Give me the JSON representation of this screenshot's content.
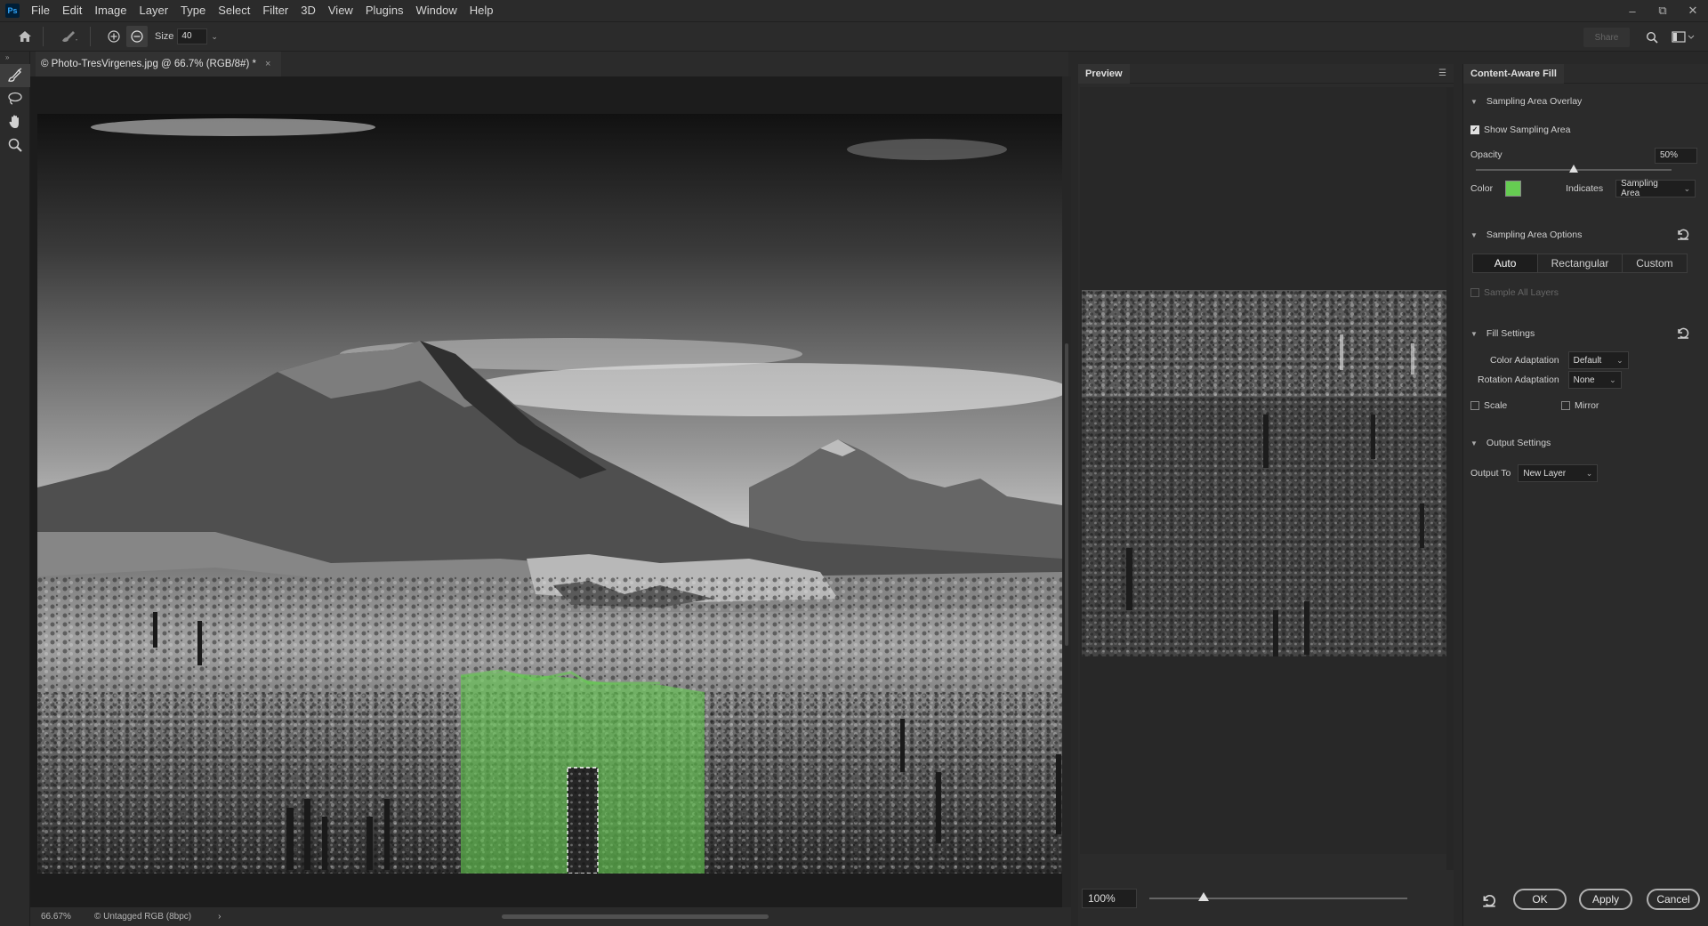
{
  "menu": {
    "app_icon": "Ps",
    "items": [
      "File",
      "Edit",
      "Image",
      "Layer",
      "Type",
      "Select",
      "Filter",
      "3D",
      "View",
      "Plugins",
      "Window",
      "Help"
    ]
  },
  "window_controls": {
    "minimize": "–",
    "restore": "⧉",
    "close": "✕"
  },
  "options_bar": {
    "size_label": "Size",
    "size_value": "40",
    "share_label": "Share",
    "icons": [
      "home-icon",
      "brush-tool-icon",
      "add-mode-icon",
      "subtract-mode-icon",
      "search-icon",
      "workspace-icon"
    ]
  },
  "tools": [
    {
      "name": "sampling-brush-tool",
      "active": true
    },
    {
      "name": "lasso-tool",
      "active": false
    },
    {
      "name": "hand-tool",
      "active": false
    },
    {
      "name": "zoom-tool",
      "active": false
    }
  ],
  "document": {
    "tab_title": "© Photo-TresVirgenes.jpg @ 66.7% (RGB/8#) *",
    "close": "×"
  },
  "status": {
    "zoom": "66.67%",
    "doc_info": "© Untagged RGB (8bpc)",
    "arrow": "›"
  },
  "preview": {
    "title": "Preview",
    "zoom_value": "100%",
    "zoom_slider_fraction": 0.21
  },
  "caf": {
    "title": "Content-Aware Fill",
    "overlay_section": "Sampling Area Overlay",
    "show_sampling_area": {
      "label": "Show Sampling Area",
      "checked": true
    },
    "opacity_label": "Opacity",
    "opacity_value": "50%",
    "opacity_fraction": 0.5,
    "color_label": "Color",
    "overlay_color": "#66cc52",
    "indicates_label": "Indicates",
    "indicates_value": "Sampling Area",
    "options_section": "Sampling Area Options",
    "sampling_modes": [
      "Auto",
      "Rectangular",
      "Custom"
    ],
    "sampling_selected": "Auto",
    "sample_all_layers": {
      "label": "Sample All Layers",
      "checked": false,
      "disabled": true
    },
    "fill_section": "Fill Settings",
    "color_adaptation_label": "Color Adaptation",
    "color_adaptation_value": "Default",
    "rotation_adaptation_label": "Rotation Adaptation",
    "rotation_adaptation_value": "None",
    "scale": {
      "label": "Scale",
      "checked": false
    },
    "mirror": {
      "label": "Mirror",
      "checked": false
    },
    "output_section": "Output Settings",
    "output_to_label": "Output To",
    "output_to_value": "New Layer",
    "buttons": {
      "ok": "OK",
      "apply": "Apply",
      "cancel": "Cancel"
    }
  }
}
